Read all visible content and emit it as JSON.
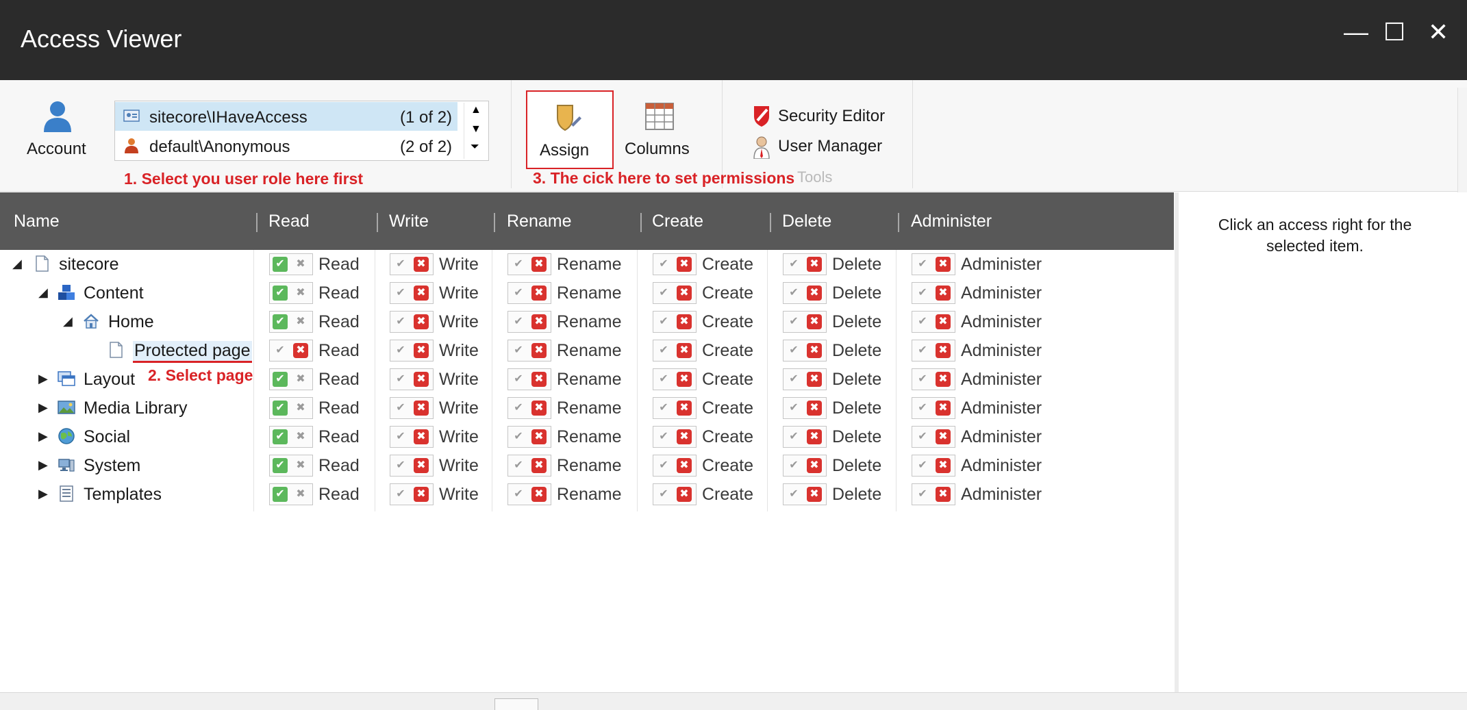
{
  "window": {
    "title": "Access Viewer",
    "controls": {
      "minimize": "—",
      "maximize": "☐",
      "close": "✕"
    }
  },
  "ribbon": {
    "account_label": "Account",
    "accounts": [
      {
        "name": "sitecore\\IHaveAccess",
        "count": "(1 of 2)",
        "selected": true
      },
      {
        "name": "default\\Anonymous",
        "count": "(2 of 2)",
        "selected": false
      }
    ],
    "assign_label": "Assign",
    "columns_label": "Columns",
    "security_editor_label": "Security Editor",
    "user_manager_label": "User Manager",
    "tools_group_label": "Tools",
    "annotation_1": "1. Select you user role here first",
    "annotation_3": "3. The cick here to set permissions"
  },
  "grid": {
    "headers": [
      "Name",
      "Read",
      "Write",
      "Rename",
      "Create",
      "Delete",
      "Administer"
    ],
    "rows": [
      {
        "label": "sitecore",
        "read_allowed": true
      },
      {
        "label": "Content",
        "read_allowed": true
      },
      {
        "label": "Home",
        "read_allowed": true
      },
      {
        "label": "Protected page",
        "read_allowed": false
      },
      {
        "label": "Layout",
        "read_allowed": true
      },
      {
        "label": "Media Library",
        "read_allowed": true
      },
      {
        "label": "Social",
        "read_allowed": true
      },
      {
        "label": "System",
        "read_allowed": true
      },
      {
        "label": "Templates",
        "read_allowed": true
      }
    ],
    "annotation_2": "2. Select page"
  },
  "details": {
    "text": "Click an access right for the selected item."
  },
  "colors": {
    "titlebar": "#2b2b2b",
    "header": "#585858",
    "allow": "#5cb85c",
    "deny": "#d9322e",
    "annotation": "#d92226"
  }
}
